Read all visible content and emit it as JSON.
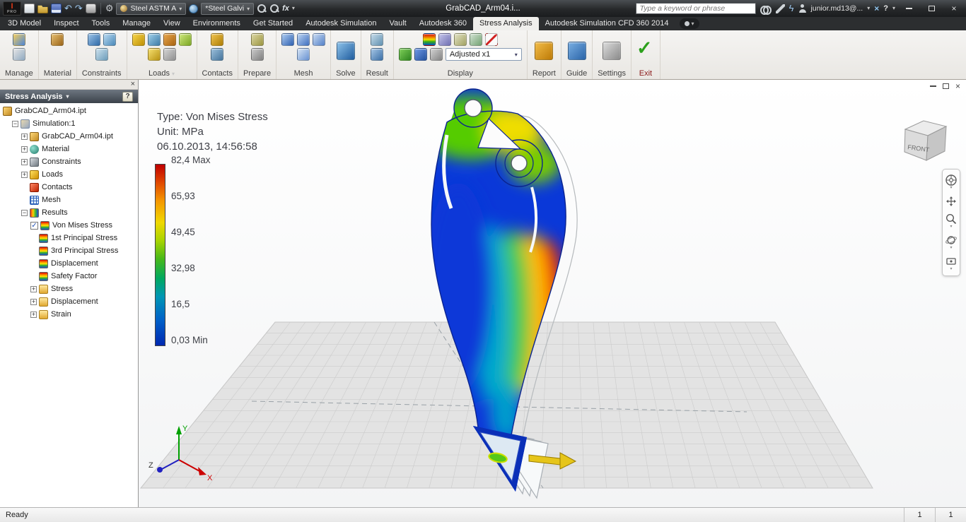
{
  "icons": {
    "undo": "↶",
    "redo": "↷",
    "gear": "⚙",
    "caret": "▾",
    "lightning": "ϟ",
    "help": "?",
    "x_badge": "×",
    "close": "×",
    "check": "✓",
    "expand": "+",
    "collapse": "−"
  },
  "title_bar": {
    "app_badge_top": "I",
    "app_badge_bottom": "PRO",
    "doc_title": "GrabCAD_Arm04.i...",
    "material_combo": "Steel ASTM A",
    "appearance_combo": "*Steel Galvi",
    "fx_label": "fx",
    "search_placeholder": "Type a keyword or phrase",
    "user_name": "junior.md13@..."
  },
  "ribbon": {
    "tabs": [
      "3D Model",
      "Inspect",
      "Tools",
      "Manage",
      "View",
      "Environments",
      "Get Started",
      "Autodesk Simulation",
      "Vault",
      "Autodesk 360",
      "Stress Analysis",
      "Autodesk Simulation CFD 360 2014"
    ],
    "active_tab": "Stress Analysis",
    "display_combo": "Adjusted x1",
    "panels": [
      {
        "label": "Manage",
        "rows": [
          [
            {
              "n": "create-simulation",
              "c": [
                "#f8d05a",
                "#4a84d8"
              ]
            }
          ],
          [
            {
              "n": "parametric-table",
              "c": [
                "#e6e6e6",
                "#8fa9c0"
              ]
            }
          ]
        ]
      },
      {
        "label": "Material",
        "rows": [
          [
            {
              "n": "assign-material",
              "c": [
                "#e8c070",
                "#9a6418"
              ]
            }
          ]
        ]
      },
      {
        "label": "Constraints",
        "rows": [
          [
            {
              "n": "fixed-constraint",
              "c": [
                "#9cc4e8",
                "#2f6aa8"
              ]
            },
            {
              "n": "pin-constraint",
              "c": [
                "#bcdcf2",
                "#4888b8"
              ]
            }
          ],
          [
            {
              "n": "frictionless-constraint",
              "c": [
                "#cde2ee",
                "#6b9cba"
              ]
            }
          ]
        ]
      },
      {
        "label": "Loads",
        "caret": true,
        "rows": [
          [
            {
              "n": "force-load",
              "c": [
                "#f8d648",
                "#bd8f06"
              ]
            },
            {
              "n": "pressure-load",
              "c": [
                "#9fd0ea",
                "#3d7ba8"
              ]
            },
            {
              "n": "bearing-load",
              "c": [
                "#eaa84e",
                "#a86310"
              ]
            },
            {
              "n": "moment-load",
              "c": [
                "#cfe87e",
                "#7aa622"
              ]
            }
          ],
          [
            {
              "n": "gravity-load",
              "c": [
                "#f6e070",
                "#b89212"
              ]
            },
            {
              "n": "remote-force-load",
              "c": [
                "#d6d6d6",
                "#8f8f8f"
              ]
            }
          ]
        ]
      },
      {
        "label": "Contacts",
        "rows": [
          [
            {
              "n": "automatic-contacts",
              "c": [
                "#f2c44e",
                "#ad7d06"
              ]
            }
          ],
          [
            {
              "n": "manual-contact",
              "c": [
                "#9cc0dc",
                "#44749c"
              ]
            }
          ]
        ]
      },
      {
        "label": "Prepare",
        "rows": [
          [
            {
              "n": "thin-bodies",
              "c": [
                "#ddd8a2",
                "#9a9440"
              ]
            }
          ],
          [
            {
              "n": "offset-shell",
              "c": [
                "#cccccc",
                "#7f7f7f"
              ]
            }
          ]
        ]
      },
      {
        "label": "Mesh",
        "rows": [
          [
            {
              "n": "mesh-view",
              "c": [
                "#aecdf2",
                "#2d5fb0"
              ]
            },
            {
              "n": "mesh-settings",
              "c": [
                "#bcd4f2",
                "#3f6fc0"
              ]
            },
            {
              "n": "local-mesh-control",
              "c": [
                "#cadcf2",
                "#5280c8"
              ]
            }
          ],
          [
            {
              "n": "convergence-settings",
              "c": [
                "#d6e4f4",
                "#6691d2"
              ]
            }
          ]
        ]
      },
      {
        "label": "Solve",
        "big": {
          "n": "simulate",
          "c": [
            "#8ec3ea",
            "#1f5c9e"
          ]
        }
      },
      {
        "label": "Result",
        "rows": [
          [
            {
              "n": "animate-results",
              "c": [
                "#c6dcea",
                "#6090b0"
              ]
            }
          ],
          [
            {
              "n": "probe",
              "c": [
                "#a6c6e6",
                "#3a6ea6"
              ]
            }
          ]
        ]
      },
      {
        "label": "Display",
        "combo": true,
        "rows": [
          [
            {
              "n": "color-bar",
              "cls": "rainbow"
            },
            {
              "n": "probe-labels",
              "c": [
                "#c4c4ea",
                "#6f6fb2"
              ]
            },
            {
              "n": "boundary-conditions",
              "c": [
                "#e2e2c4",
                "#a2a262"
              ]
            },
            {
              "n": "max-min-values",
              "c": [
                "#d2e2d2",
                "#72a272"
              ]
            },
            {
              "n": "no-symbols",
              "cls": "noslash"
            }
          ],
          [
            {
              "n": "shaded-display",
              "c": [
                "#7ecf58",
                "#2e8420"
              ]
            },
            {
              "n": "wireframe-display",
              "c": [
                "#6f98e6",
                "#24529e"
              ]
            },
            {
              "n": "adjusted-displacement",
              "c": [
                "#d4d4d4",
                "#838383"
              ]
            }
          ]
        ]
      },
      {
        "label": "Report",
        "big": {
          "n": "report",
          "c": [
            "#f2bc48",
            "#bd7a06"
          ]
        }
      },
      {
        "label": "Guide",
        "big": {
          "n": "simulation-guide",
          "c": [
            "#79aee2",
            "#2a64a8"
          ]
        }
      },
      {
        "label": "Settings",
        "big": {
          "n": "stress-analysis-settings",
          "c": [
            "#dcdcdc",
            "#8a8a8a"
          ]
        }
      },
      {
        "label": "Exit",
        "big": {
          "n": "finish-stress-analysis",
          "cls": "check"
        },
        "label_color": "#8b1a1a"
      }
    ]
  },
  "browser": {
    "panel_title": "Stress Analysis",
    "help_glyph": "?",
    "tree": [
      {
        "label": "GrabCAD_Arm04.ipt",
        "depth": 0,
        "icon": "part",
        "expander": null,
        "root": true
      },
      {
        "label": "Simulation:1",
        "depth": 1,
        "icon": "sim",
        "expander": "minus"
      },
      {
        "label": "GrabCAD_Arm04.ipt",
        "depth": 2,
        "icon": "part",
        "expander": "plus"
      },
      {
        "label": "Material",
        "depth": 2,
        "icon": "material",
        "expander": "plus"
      },
      {
        "label": "Constraints",
        "depth": 2,
        "icon": "constraints",
        "expander": "plus"
      },
      {
        "label": "Loads",
        "depth": 2,
        "icon": "loads",
        "expander": "plus"
      },
      {
        "label": "Contacts",
        "depth": 2,
        "icon": "contacts",
        "expander": null
      },
      {
        "label": "Mesh",
        "depth": 2,
        "icon": "mesh",
        "expander": null
      },
      {
        "label": "Results",
        "depth": 2,
        "icon": "results",
        "expander": "minus"
      },
      {
        "label": "Von Mises Stress",
        "depth": 3,
        "icon": "rainbow",
        "expander": null,
        "checkbox": true
      },
      {
        "label": "1st Principal Stress",
        "depth": 3,
        "icon": "rainbow",
        "expander": null
      },
      {
        "label": "3rd Principal Stress",
        "depth": 3,
        "icon": "rainbow",
        "expander": null
      },
      {
        "label": "Displacement",
        "depth": 3,
        "icon": "rainbow",
        "expander": null
      },
      {
        "label": "Safety Factor",
        "depth": 3,
        "icon": "rainbow",
        "expander": null
      },
      {
        "label": "Stress",
        "depth": 3,
        "icon": "folder",
        "expander": "plus"
      },
      {
        "label": "Displacement",
        "depth": 3,
        "icon": "folder",
        "expander": "plus"
      },
      {
        "label": "Strain",
        "depth": 3,
        "icon": "folder",
        "expander": "plus"
      }
    ]
  },
  "viewport": {
    "annotation": {
      "type_label": "Type: Von Mises Stress",
      "unit_label": "Unit: MPa",
      "timestamp": "06.10.2013, 14:56:58"
    },
    "legend": {
      "unit": "MPa",
      "labels": [
        "82,4 Max",
        "65,93",
        "49,45",
        "32,98",
        "16,5",
        "0,03 Min"
      ]
    },
    "viewcube_label": "FRONT",
    "triad": {
      "x": "X",
      "y": "Y",
      "z": "Z"
    }
  },
  "status_bar": {
    "message": "Ready",
    "counts": [
      "1",
      "1"
    ]
  }
}
